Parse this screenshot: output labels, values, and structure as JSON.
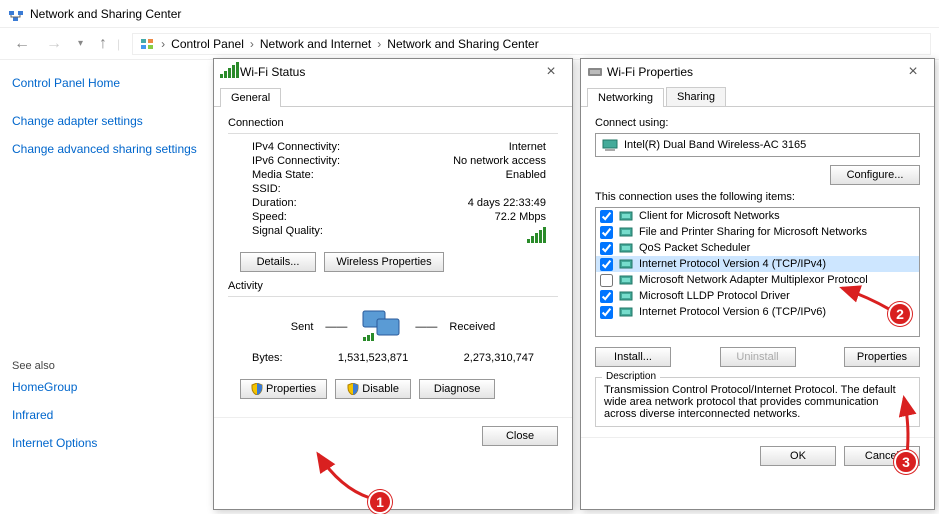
{
  "window_title": "Network and Sharing Center",
  "breadcrumb": [
    "Control Panel",
    "Network and Internet",
    "Network and Sharing Center"
  ],
  "sidebar": {
    "home": "Control Panel Home",
    "links": [
      "Change adapter settings",
      "Change advanced sharing settings"
    ],
    "see_also_heading": "See also",
    "see_also": [
      "HomeGroup",
      "Infrared",
      "Internet Options"
    ]
  },
  "status_dialog": {
    "title": "Wi-Fi Status",
    "tab": "General",
    "connection_label": "Connection",
    "rows": {
      "ipv4_label": "IPv4 Connectivity:",
      "ipv4_value": "Internet",
      "ipv6_label": "IPv6 Connectivity:",
      "ipv6_value": "No network access",
      "media_label": "Media State:",
      "media_value": "Enabled",
      "ssid_label": "SSID:",
      "ssid_value": "",
      "duration_label": "Duration:",
      "duration_value": "4 days 22:33:49",
      "speed_label": "Speed:",
      "speed_value": "72.2 Mbps",
      "signal_label": "Signal Quality:"
    },
    "details_btn": "Details...",
    "wireless_btn": "Wireless Properties",
    "activity_label": "Activity",
    "sent_label": "Sent",
    "received_label": "Received",
    "bytes_label": "Bytes:",
    "bytes_sent": "1,531,523,871",
    "bytes_received": "2,273,310,747",
    "properties_btn": "Properties",
    "disable_btn": "Disable",
    "diagnose_btn": "Diagnose",
    "close_btn": "Close"
  },
  "props_dialog": {
    "title": "Wi-Fi Properties",
    "tabs": [
      "Networking",
      "Sharing"
    ],
    "connect_using_label": "Connect using:",
    "adapter": "Intel(R) Dual Band Wireless-AC 3165",
    "configure_btn": "Configure...",
    "items_label": "This connection uses the following items:",
    "items": [
      {
        "checked": true,
        "label": "Client for Microsoft Networks"
      },
      {
        "checked": true,
        "label": "File and Printer Sharing for Microsoft Networks"
      },
      {
        "checked": true,
        "label": "QoS Packet Scheduler"
      },
      {
        "checked": true,
        "label": "Internet Protocol Version 4 (TCP/IPv4)",
        "selected": true
      },
      {
        "checked": false,
        "label": "Microsoft Network Adapter Multiplexor Protocol"
      },
      {
        "checked": true,
        "label": "Microsoft LLDP Protocol Driver"
      },
      {
        "checked": true,
        "label": "Internet Protocol Version 6 (TCP/IPv6)"
      }
    ],
    "install_btn": "Install...",
    "uninstall_btn": "Uninstall",
    "properties_btn": "Properties",
    "description_label": "Description",
    "description_text": "Transmission Control Protocol/Internet Protocol. The default wide area network protocol that provides communication across diverse interconnected networks.",
    "ok_btn": "OK",
    "cancel_btn": "Cancel"
  },
  "annotations": [
    "1",
    "2",
    "3"
  ]
}
